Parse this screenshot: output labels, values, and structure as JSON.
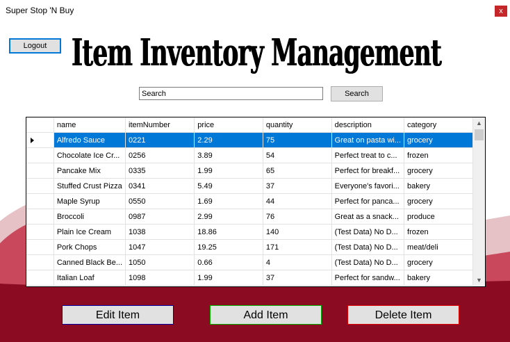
{
  "window": {
    "title": "Super Stop 'N Buy",
    "close_label": "x"
  },
  "logout_label": "Logout",
  "heading": "Item Inventory Management",
  "search": {
    "value": "Search",
    "button_label": "Search"
  },
  "table": {
    "columns": [
      "name",
      "itemNumber",
      "price",
      "quantity",
      "description",
      "category"
    ],
    "selected_row": 0,
    "rows": [
      [
        "Alfredo Sauce",
        "0221",
        "2.29",
        "75",
        "Great on pasta wi...",
        "grocery"
      ],
      [
        "Chocolate Ice Cr...",
        "0256",
        "3.89",
        "54",
        "Perfect treat to c...",
        "frozen"
      ],
      [
        "Pancake Mix",
        "0335",
        "1.99",
        "65",
        "Perfect for breakf...",
        "grocery"
      ],
      [
        "Stuffed Crust Pizza",
        "0341",
        "5.49",
        "37",
        "Everyone's favori...",
        "bakery"
      ],
      [
        "Maple Syrup",
        "0550",
        "1.69",
        "44",
        "Perfect for panca...",
        "grocery"
      ],
      [
        "Broccoli",
        "0987",
        "2.99",
        "76",
        "Great as a snack...",
        "produce"
      ],
      [
        "Plain Ice Cream",
        "1038",
        "18.86",
        "140",
        "(Test Data) No D...",
        "frozen"
      ],
      [
        "Pork Chops",
        "1047",
        "19.25",
        "171",
        "(Test Data) No D...",
        "meat/deli"
      ],
      [
        "Canned Black Be...",
        "1050",
        "0.66",
        "4",
        "(Test Data) No D...",
        "grocery"
      ],
      [
        "Italian Loaf",
        "1098",
        "1.99",
        "37",
        "Perfect for sandw...",
        "bakery"
      ]
    ]
  },
  "actions": {
    "edit_label": "Edit Item",
    "add_label": "Add Item",
    "delete_label": "Delete Item"
  },
  "colors": {
    "accent": "#0078d7",
    "maroon": "#8b0b23",
    "close": "#c5262a"
  }
}
